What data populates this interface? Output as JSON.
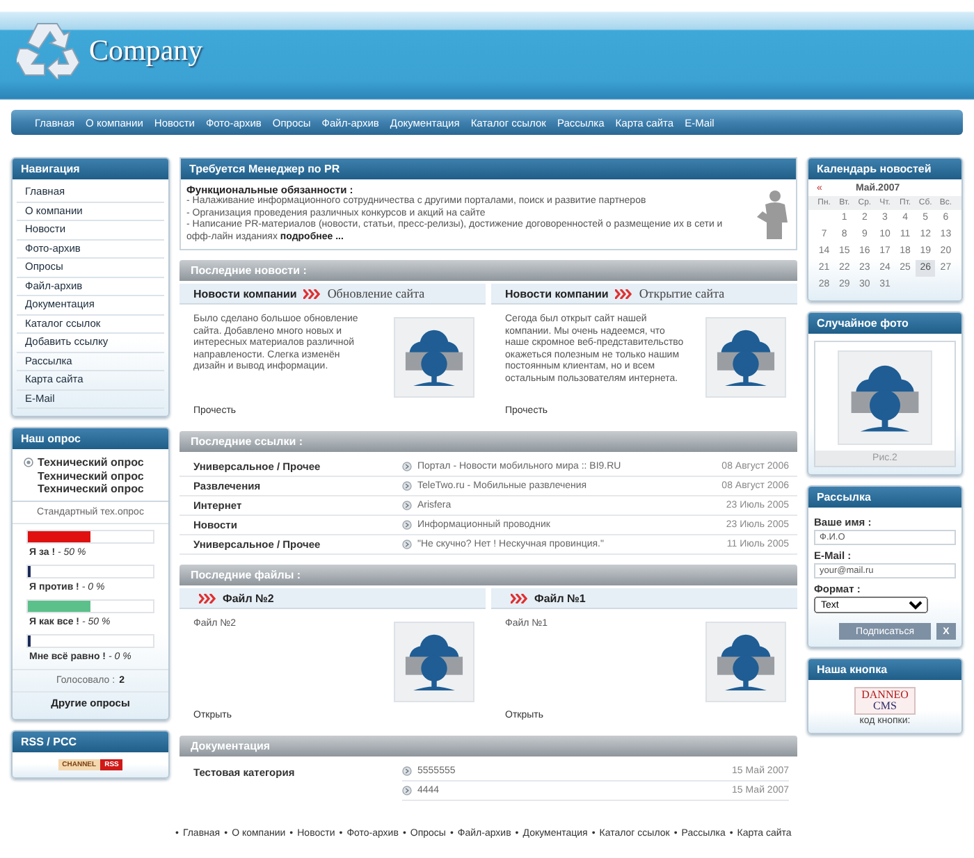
{
  "header": {
    "logo_text": "Company"
  },
  "top_nav": [
    "Главная",
    "О компании",
    "Новости",
    "Фото-архив",
    "Опросы",
    "Файл-архив",
    "Документация",
    "Каталог ссылок",
    "Рассылка",
    "Карта сайта",
    "E-Mail"
  ],
  "left": {
    "navigation": {
      "title": "Навигация",
      "items": [
        "Главная",
        "О компании",
        "Новости",
        "Фото-архив",
        "Опросы",
        "Файл-архив",
        "Документация",
        "Каталог ссылок",
        "Добавить ссылку",
        "Рассылка",
        "Карта сайта",
        "E-Mail"
      ]
    },
    "poll": {
      "title": "Наш опрос",
      "question": "Технический опрос Технический опрос Технический опрос",
      "subtitle": "Стандартный тех.опрос",
      "options": [
        {
          "text": "**Я за !** *- 50 %*",
          "level": 0.5,
          "color": "#e01010"
        },
        {
          "text": "**Я против !** *- 0 %*",
          "level": 0,
          "color": "#1c2a5a"
        },
        {
          "text": "**Я как все !** *- 50 %*",
          "level": 0.5,
          "color": "#5cc08a"
        },
        {
          "text": "**Мне всё равно !** *- 0 %*",
          "level": 0,
          "color": "#1c2a5a"
        }
      ],
      "votes_label": "Голосовало :",
      "votes": "2",
      "others": "Другие опросы"
    },
    "rss": {
      "title": "RSS / PCC",
      "badge_left": "CHANNEL",
      "badge_right": "RSS"
    }
  },
  "center": {
    "vacancy": {
      "title": "Требуется Менеджер по PR",
      "heading": "Функциональные обязанности :",
      "lines": [
        "- Налаживание информационного сотрудничества с другими порталами, поиск и развитие партнеров",
        "- Организация проведения различных конкурсов и акций на сайте",
        "- Написание PR-материалов (новости, статьи, пресс-релизы), достижение договоренностей о размещение их в сети и офф-лайн изданиях"
      ],
      "more": "подробнее ..."
    },
    "news": {
      "title": "Последние новости :",
      "items": [
        {
          "category": "Новости компании",
          "title": "Обновление сайта",
          "text": "Было сделано большое обновление сайта. Добавлено много новых и интересных материалов различной направлености. Слегка изменён дизайн и вывод информации.",
          "read": "Прочесть"
        },
        {
          "category": "Новости компании",
          "title": "Открытие сайта",
          "text": "Сегода был открыт сайт нашей компании. Мы очень надеемся, что наше скромное веб-представительство окажеться полезным не только нашим постоянным клиентам, но и всем остальным пользователям интернета.",
          "read": "Прочесть"
        }
      ]
    },
    "links": {
      "title": "Последние ссылки :",
      "rows": [
        {
          "category": "Универсальное / Прочее",
          "title": "Портал - Новости мобильного мира :: BI9.RU",
          "date": "08 Август 2006"
        },
        {
          "category": "Развлечения",
          "title": "TeleTwo.ru - Мобильные развлечения",
          "date": "08 Август 2006"
        },
        {
          "category": "Интернет",
          "title": "Arisfera",
          "date": "23 Июль 2005"
        },
        {
          "category": "Новости",
          "title": "Информационный проводник",
          "date": "23 Июль 2005"
        },
        {
          "category": "Универсальное / Прочее",
          "title": "\"Не скучно? Нет ! Нескучная провинция.\"",
          "date": "11 Июль 2005"
        }
      ]
    },
    "files": {
      "title": "Последние файлы :",
      "items": [
        {
          "title": "Файл №2",
          "text": "Файл №2",
          "open": "Открыть"
        },
        {
          "title": "Файл №1",
          "text": "Файл №1",
          "open": "Открыть"
        }
      ]
    },
    "docs": {
      "title": "Документация",
      "category": "Тестовая категория",
      "rows": [
        {
          "title": "5555555",
          "date": "15 Май 2007"
        },
        {
          "title": "4444",
          "date": "15 Май 2007"
        }
      ]
    }
  },
  "right": {
    "calendar": {
      "title": "Календарь новостей",
      "prev": "«",
      "month": "Май.2007",
      "weekdays": [
        "Пн.",
        "Вт.",
        "Ср.",
        "Чт.",
        "Пт.",
        "Сб.",
        "Вс."
      ],
      "weeks": [
        [
          {
            "d": "1",
            "selected": false
          },
          {
            "d": "2",
            "selected": false
          },
          {
            "d": "3",
            "selected": false
          },
          {
            "d": "4",
            "selected": false
          },
          {
            "d": "5",
            "selected": false
          },
          {
            "d": "6",
            "selected": false
          }
        ],
        [
          {
            "d": "7",
            "selected": false
          },
          {
            "d": "8",
            "selected": false
          },
          {
            "d": "9",
            "selected": false
          },
          {
            "d": "10",
            "selected": false
          },
          {
            "d": "11",
            "selected": false
          },
          {
            "d": "12",
            "selected": false
          },
          {
            "d": "13",
            "selected": false
          }
        ],
        [
          {
            "d": "14",
            "selected": false
          },
          {
            "d": "15",
            "selected": false
          },
          {
            "d": "16",
            "selected": false
          },
          {
            "d": "17",
            "selected": false
          },
          {
            "d": "18",
            "selected": false
          },
          {
            "d": "19",
            "selected": false
          },
          {
            "d": "20",
            "selected": false
          }
        ],
        [
          {
            "d": "21",
            "selected": false
          },
          {
            "d": "22",
            "selected": false
          },
          {
            "d": "23",
            "selected": false
          },
          {
            "d": "24",
            "selected": false
          },
          {
            "d": "25",
            "selected": false
          },
          {
            "d": "26",
            "selected": true
          },
          {
            "d": "27",
            "selected": false
          }
        ],
        [
          {
            "d": "28",
            "selected": false
          },
          {
            "d": "29",
            "selected": false
          },
          {
            "d": "30",
            "selected": false
          },
          {
            "d": "31",
            "selected": false
          }
        ]
      ]
    },
    "photo": {
      "title": "Случайное фото",
      "caption": "Рис.2"
    },
    "subscribe": {
      "title": "Рассылка",
      "fields": [
        {
          "label": "Ваше имя :",
          "value": "Ф.И.О"
        },
        {
          "label": "E-Mail :",
          "value": "your@mail.ru"
        }
      ],
      "format_label": "Формат :",
      "format": "Text",
      "submit": "Подписаться",
      "close": "X"
    },
    "our_button": {
      "title": "Наша кнопка",
      "badge_top": "DANNEO",
      "badge_bottom": "CMS",
      "caption": "код кнопки:"
    }
  },
  "footer_nav": {
    "separator": "•",
    "items": [
      "Главная",
      "О компании",
      "Новости",
      "Фото-архив",
      "Опросы",
      "Файл-архив",
      "Документация",
      "Каталог ссылок",
      "Рассылка",
      "Карта сайта"
    ]
  }
}
